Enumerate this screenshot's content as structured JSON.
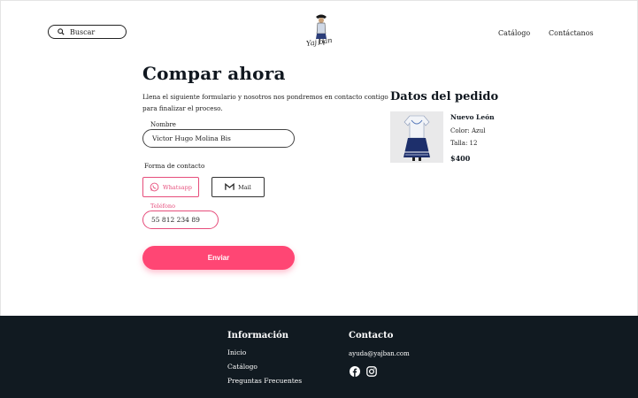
{
  "header": {
    "search_placeholder": "Buscar",
    "logo_text": "Yaj ban",
    "nav": {
      "catalog": "Catálogo",
      "contact": "Contáctanos"
    }
  },
  "form": {
    "title": "Compar ahora",
    "intro": "Llena el siguiente formulario y nosotros nos pondremos en contacto contigo para finalizar el proceso.",
    "name_label": "Nombre",
    "name_value": "Victor Hugo Molina Bis",
    "contact_label": "Forma de contacto",
    "whatsapp_label": "Whatsapp",
    "mail_label": "Mail",
    "phone_label": "Teléfono",
    "phone_value": "55 812 234 89",
    "submit_label": "Enviar"
  },
  "order": {
    "title": "Datos del pedido",
    "product_name": "Nuevo León",
    "color": "Color: Azul",
    "size": "Talla: 12",
    "price": "$400"
  },
  "footer": {
    "info_title": "Información",
    "links": [
      "Inicio",
      "Catálogo",
      "Preguntas Frecuentes"
    ],
    "contact_title": "Contacto",
    "email": "ayuda@yajban.com"
  },
  "colors": {
    "accent": "#ff4674",
    "accent_outline": "#e64d7b",
    "footer_bg": "#111a21"
  },
  "icons": [
    "search-icon",
    "whatsapp-icon",
    "mail-icon",
    "facebook-icon",
    "instagram-icon"
  ]
}
